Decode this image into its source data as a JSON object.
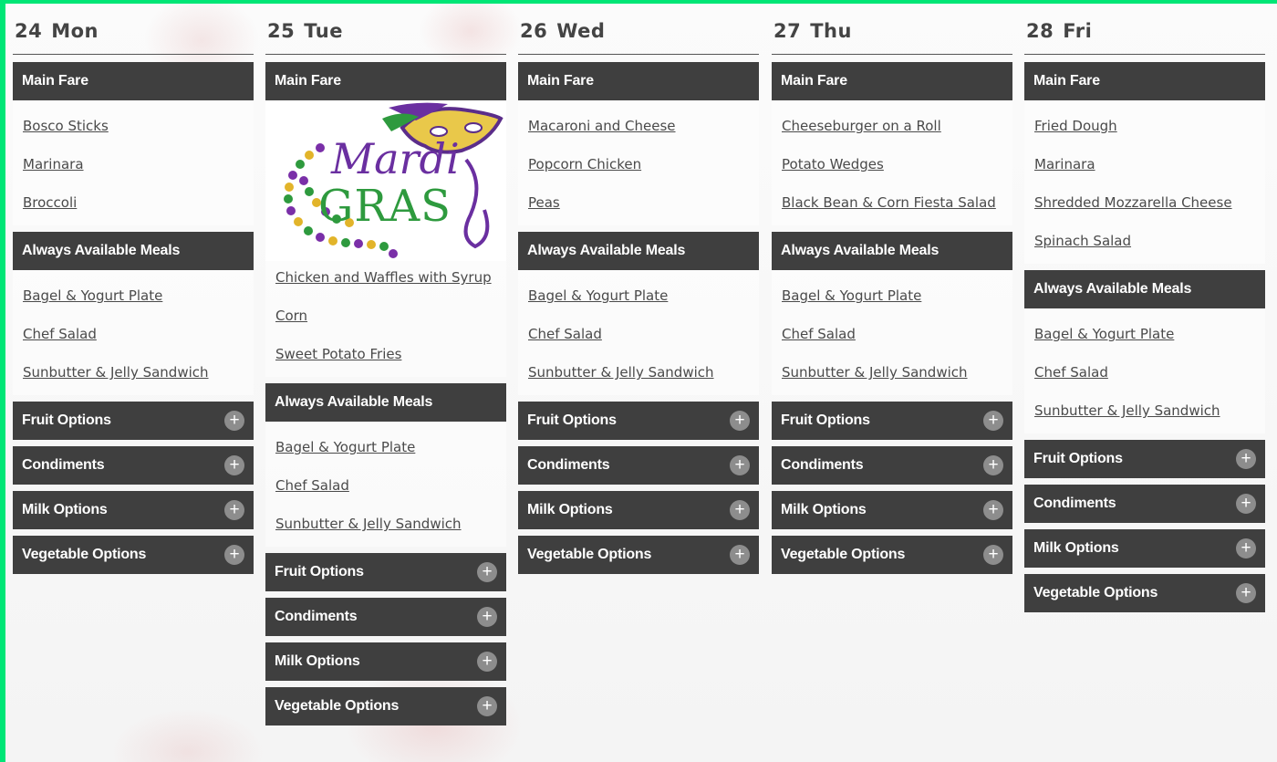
{
  "days": [
    {
      "num": "24",
      "name": "Mon",
      "main_fare_label": "Main Fare",
      "main_items": [
        "Bosco Sticks",
        "Marinara",
        "Broccoli"
      ],
      "always_label": "Always Available Meals",
      "always_items": [
        "Bagel & Yogurt Plate",
        "Chef Salad",
        "Sunbutter & Jelly Sandwich"
      ],
      "sections": [
        "Fruit Options",
        "Condiments",
        "Milk Options",
        "Vegetable Options"
      ]
    },
    {
      "num": "25",
      "name": "Tue",
      "main_fare_label": "Main Fare",
      "image_alt": "Mardi Gras",
      "main_items": [
        "Chicken and Waffles with Syrup",
        "Corn",
        "Sweet Potato Fries"
      ],
      "always_label": "Always Available Meals",
      "always_items": [
        "Bagel & Yogurt Plate",
        "Chef Salad",
        "Sunbutter & Jelly Sandwich"
      ],
      "sections": [
        "Fruit Options",
        "Condiments",
        "Milk Options",
        "Vegetable Options"
      ]
    },
    {
      "num": "26",
      "name": "Wed",
      "main_fare_label": "Main Fare",
      "main_items": [
        "Macaroni and Cheese",
        "Popcorn Chicken",
        "Peas"
      ],
      "always_label": "Always Available Meals",
      "always_items": [
        "Bagel & Yogurt Plate",
        "Chef Salad",
        "Sunbutter & Jelly Sandwich"
      ],
      "sections": [
        "Fruit Options",
        "Condiments",
        "Milk Options",
        "Vegetable Options"
      ]
    },
    {
      "num": "27",
      "name": "Thu",
      "main_fare_label": "Main Fare",
      "main_items": [
        "Cheeseburger on a Roll",
        "Potato Wedges",
        "Black Bean & Corn Fiesta Salad"
      ],
      "always_label": "Always Available Meals",
      "always_items": [
        "Bagel & Yogurt Plate",
        "Chef Salad",
        "Sunbutter & Jelly Sandwich"
      ],
      "sections": [
        "Fruit Options",
        "Condiments",
        "Milk Options",
        "Vegetable Options"
      ]
    },
    {
      "num": "28",
      "name": "Fri",
      "main_fare_label": "Main Fare",
      "main_items": [
        "Fried Dough",
        "Marinara",
        "Shredded Mozzarella Cheese",
        "Spinach Salad"
      ],
      "always_label": "Always Available Meals",
      "always_items": [
        "Bagel & Yogurt Plate",
        "Chef Salad",
        "Sunbutter & Jelly Sandwich"
      ],
      "sections": [
        "Fruit Options",
        "Condiments",
        "Milk Options",
        "Vegetable Options"
      ]
    }
  ],
  "expand_glyph": "+",
  "colors": {
    "bar": "#3f3f3f",
    "border": "#00e676",
    "link": "#4a4a4a"
  }
}
